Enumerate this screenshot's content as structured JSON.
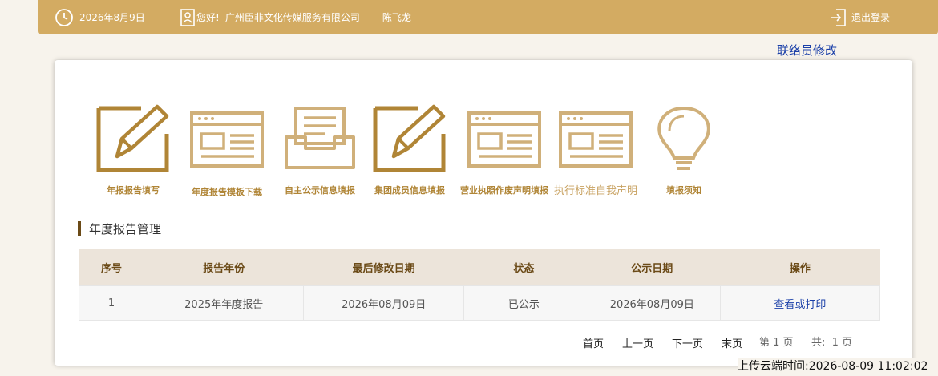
{
  "header": {
    "date": "2026年8月9日",
    "greeting": "您好!",
    "company": "广州臣非文化传媒服务有限公司",
    "user": "陈飞龙",
    "logout": "退出登录",
    "bar_color": "#d3ab62"
  },
  "modify_link": "联络员修改",
  "icons": [
    {
      "icon": "pen-on-paper-icon",
      "label": "年报报告填写"
    },
    {
      "icon": "document-template-icon",
      "label": "年度报告模板下载"
    },
    {
      "icon": "inbox-tray-icon",
      "label": "自主公示信息填报"
    },
    {
      "icon": "pen-on-paper-icon",
      "label": "集团成员信息填报"
    },
    {
      "icon": "document-template-icon",
      "label": "营业执照作废声明填报"
    },
    {
      "icon": "document-template-icon",
      "label": "执行标准自我声明"
    },
    {
      "icon": "lightbulb-icon",
      "label": "填报须知"
    }
  ],
  "section_title": "年度报告管理",
  "table": {
    "headers": [
      "序号",
      "报告年份",
      "最后修改日期",
      "状态",
      "公示日期",
      "操作"
    ],
    "rows": [
      {
        "index": "1",
        "year": "2025年年度报告",
        "modified": "2026年08月09日",
        "status": "已公示",
        "published": "2026年08月09日",
        "action": "查看或打印"
      }
    ]
  },
  "pagination": {
    "first": "首页",
    "prev": "上一页",
    "next": "下一页",
    "last": "末页",
    "current": "第 1 页",
    "total": "共:  1 页"
  },
  "upload_time": "上传云端时间:2026-08-09 11:02:02"
}
